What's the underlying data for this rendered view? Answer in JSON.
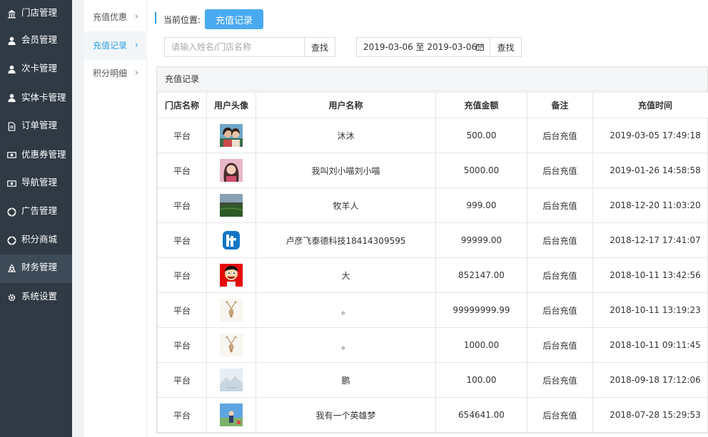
{
  "sidebar": {
    "items": [
      {
        "label": "门店管理",
        "icon": "bank-icon"
      },
      {
        "label": "会员管理",
        "icon": "user-icon"
      },
      {
        "label": "次卡管理",
        "icon": "user-icon"
      },
      {
        "label": "实体卡管理",
        "icon": "user-icon"
      },
      {
        "label": "订单管理",
        "icon": "document-icon"
      },
      {
        "label": "优惠券管理",
        "icon": "money-icon"
      },
      {
        "label": "导航管理",
        "icon": "money-icon"
      },
      {
        "label": "广告管理",
        "icon": "lifebuoy-icon"
      },
      {
        "label": "积分商城",
        "icon": "lifebuoy-icon"
      },
      {
        "label": "财务管理",
        "icon": "recycle-icon"
      },
      {
        "label": "系统设置",
        "icon": "gear-icon"
      }
    ],
    "active": "财务管理"
  },
  "submenu": {
    "items": [
      {
        "label": "充值优惠"
      },
      {
        "label": "充值记录"
      },
      {
        "label": "积分明细"
      }
    ],
    "active": "充值记录"
  },
  "breadcrumb": {
    "label": "当前位置:",
    "current": "充值记录"
  },
  "search": {
    "placeholder": "请输入姓名/门店名称",
    "button": "查找"
  },
  "date_filter": {
    "value": "2019-03-06 至 2019-03-06",
    "button": "查找"
  },
  "panel": {
    "title": "充值记录",
    "columns": [
      "门店名称",
      "用户头像",
      "用户名称",
      "充值金额",
      "备注",
      "充值时间"
    ],
    "rows": [
      {
        "store": "平台",
        "avatar": "avatar-couple",
        "name": "沐沐",
        "amount": "500.00",
        "note": "后台充值",
        "time": "2019-03-05 17:49:18"
      },
      {
        "store": "平台",
        "avatar": "avatar-girl",
        "name": "我叫刘小喵刘小喵",
        "amount": "5000.00",
        "note": "后台充值",
        "time": "2019-01-26 14:58:58"
      },
      {
        "store": "平台",
        "avatar": "avatar-field",
        "name": "牧羊人",
        "amount": "999.00",
        "note": "后台充值",
        "time": "2018-12-20 11:03:20"
      },
      {
        "store": "平台",
        "avatar": "avatar-logo-t",
        "name": "卢彦飞泰德科技18414309595",
        "amount": "99999.00",
        "note": "后台充值",
        "time": "2018-12-17 17:41:07"
      },
      {
        "store": "平台",
        "avatar": "avatar-cartoon",
        "name": "大",
        "amount": "852147.00",
        "note": "后台充值",
        "time": "2018-10-11 13:42:56"
      },
      {
        "store": "平台",
        "avatar": "avatar-deer",
        "name": "。",
        "amount": "99999999.99",
        "note": "后台充值",
        "time": "2018-10-11 13:19:23"
      },
      {
        "store": "平台",
        "avatar": "avatar-deer",
        "name": "。",
        "amount": "1000.00",
        "note": "后台充值",
        "time": "2018-10-11 09:11:45"
      },
      {
        "store": "平台",
        "avatar": "avatar-landscape",
        "name": "鹏",
        "amount": "100.00",
        "note": "后台充值",
        "time": "2018-09-18 17:12:06"
      },
      {
        "store": "平台",
        "avatar": "avatar-sky",
        "name": "我有一个英雄梦",
        "amount": "654641.00",
        "note": "后台充值",
        "time": "2018-07-28 15:29:53"
      }
    ]
  },
  "colors": {
    "sidebar_bg": "#2f3a45",
    "accent": "#2d9de0",
    "button_blue": "#4aaaf0"
  }
}
